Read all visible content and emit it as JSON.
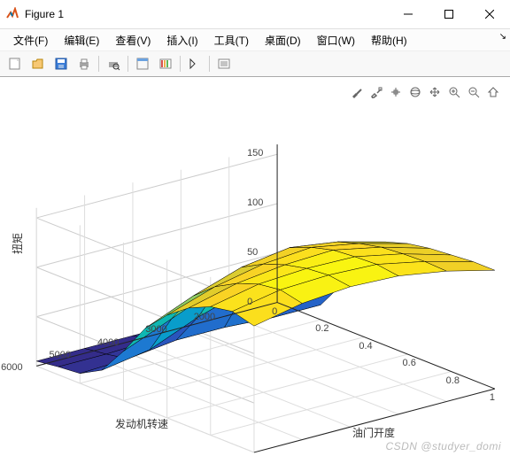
{
  "window": {
    "title": "Figure 1"
  },
  "menu": {
    "file": "文件(F)",
    "edit": "编辑(E)",
    "view": "查看(V)",
    "insert": "插入(I)",
    "tools": "工具(T)",
    "desktop": "桌面(D)",
    "window": "窗口(W)",
    "help": "帮助(H)"
  },
  "toolbar_icons": [
    "new",
    "open",
    "save",
    "print",
    "sep",
    "print-preview",
    "sep",
    "dock",
    "insert-colorbar",
    "sep",
    "arrow",
    "sep",
    "link-property"
  ],
  "axes_icons": [
    "brush",
    "restore",
    "cursor",
    "rotate3d",
    "pan",
    "zoom-in",
    "zoom-out",
    "home"
  ],
  "chart_data": {
    "type": "surface",
    "xlabel": "油门开度",
    "x_ticks": [
      0,
      0.2,
      0.4,
      0.6,
      0.8,
      1
    ],
    "ylabel": "发动机转速",
    "y_ticks": [
      2000,
      3000,
      4000,
      5000,
      6000
    ],
    "zlabel": "扭矩",
    "z_ticks": [
      0,
      50,
      100,
      150
    ],
    "x": [
      0,
      0.1,
      0.2,
      0.3,
      0.4,
      0.5,
      0.6,
      0.7,
      0.8,
      0.9,
      1.0
    ],
    "y": [
      1000,
      2000,
      3000,
      4000,
      5000,
      6000
    ],
    "z": [
      [
        5,
        10,
        15,
        45,
        85,
        105,
        112,
        116,
        118,
        120,
        120
      ],
      [
        5,
        10,
        15,
        60,
        98,
        118,
        125,
        130,
        132,
        133,
        132
      ],
      [
        5,
        10,
        18,
        65,
        105,
        125,
        134,
        140,
        142,
        143,
        140
      ],
      [
        5,
        10,
        18,
        50,
        90,
        118,
        130,
        138,
        143,
        145,
        142
      ],
      [
        5,
        8,
        12,
        30,
        70,
        102,
        120,
        132,
        140,
        143,
        138
      ],
      [
        5,
        8,
        10,
        22,
        50,
        82,
        104,
        120,
        130,
        134,
        128
      ]
    ],
    "colormap": "parula"
  },
  "watermark": "CSDN @studyer_domi"
}
